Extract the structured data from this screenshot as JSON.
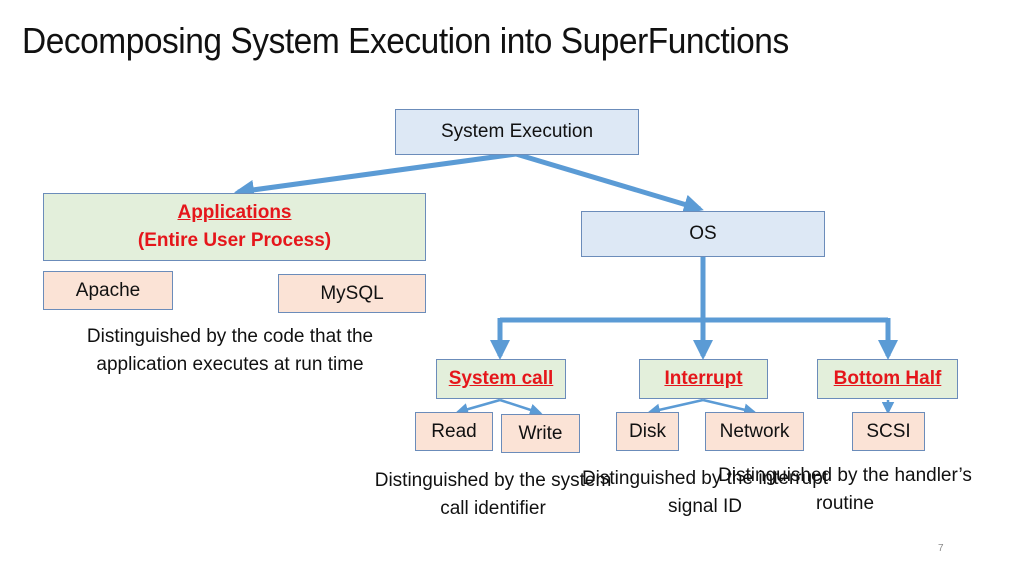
{
  "slide": {
    "title": "Decomposing System Execution into SuperFunctions",
    "page_number": "7"
  },
  "diagram": {
    "root": {
      "label": "System Execution"
    },
    "applications": {
      "label": "Applications",
      "sublabel": "(Entire User Process)",
      "children": [
        {
          "label": "Apache"
        },
        {
          "label": "MySQL"
        }
      ],
      "note_line1": "Distinguished by the code that the",
      "note_line2": "application executes at run time"
    },
    "os": {
      "label": "OS",
      "children": [
        {
          "label": "System call",
          "children": [
            {
              "label": "Read"
            },
            {
              "label": "Write"
            }
          ],
          "note_line1": "Distinguished by the system",
          "note_line2": "call identifier"
        },
        {
          "label": "Interrupt",
          "children": [
            {
              "label": "Disk"
            },
            {
              "label": "Network"
            }
          ],
          "note_line1": "Distinguished by the interrupt",
          "note_line2": "signal ID"
        },
        {
          "label": "Bottom Half",
          "children": [
            {
              "label": "SCSI"
            }
          ],
          "note_line1": "Distinguished by the handler’s",
          "note_line2": "routine"
        }
      ]
    }
  },
  "colors": {
    "arrow": "#5b9bd5",
    "highlight_text": "#e5161b",
    "blue_box": "#dde8f5",
    "green_box": "#e3efdb",
    "peach_box": "#fbe3d6"
  }
}
